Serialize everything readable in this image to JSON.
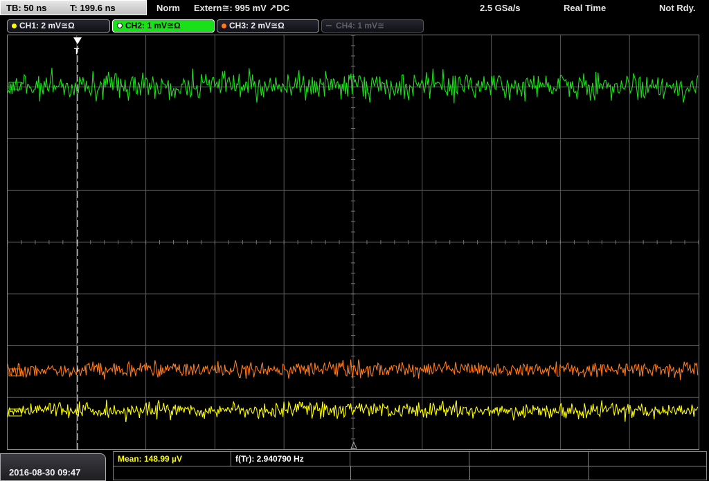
{
  "topbar": {
    "timebase": "TB: 50 ns",
    "trigger_time": "T: 199.6 ns",
    "mode": "Norm",
    "trigger": "Extern≅: 995 mV ↗DC",
    "sample_rate": "2.5 GSa/s",
    "acq_mode": "Real Time",
    "status": "Not Rdy."
  },
  "channels": [
    {
      "label": "CH1: 2 mV≅Ω",
      "color": "#ffff00",
      "state": "on"
    },
    {
      "label": "CH2: 1 mV≅Ω",
      "color": "#19e019",
      "state": "active"
    },
    {
      "label": "CH3: 2 mV≅Ω",
      "color": "#ff7a1a",
      "state": "on"
    },
    {
      "label": "CH4: 1 mV≅",
      "color": "#555555",
      "state": "off"
    }
  ],
  "trigger_marker": "T",
  "measurements": {
    "mean": "Mean: 148.99 µV",
    "freq": "f(Tr): 2.940790 Hz"
  },
  "datetime": "2016-08-30 09:47",
  "colors": {
    "ch1": "#ffff00",
    "ch2": "#19e019",
    "ch3": "#ff7a1a",
    "grid": "#5a5a5a"
  }
}
